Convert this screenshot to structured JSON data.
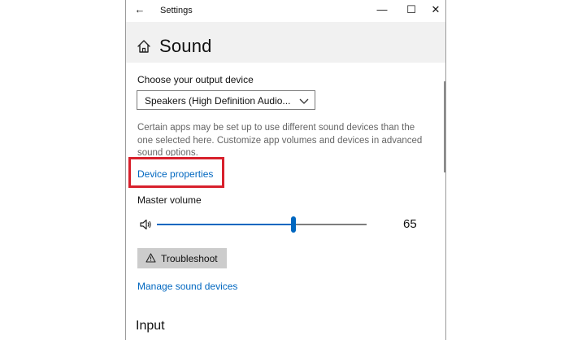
{
  "window": {
    "title": "Settings",
    "controls": {
      "back": "←",
      "minimize": "—",
      "maximize": "☐",
      "close": "✕"
    }
  },
  "page": {
    "title": "Sound"
  },
  "output": {
    "label": "Choose your output device",
    "selected_device": "Speakers (High Definition Audio...",
    "help_text": "Certain apps may be set up to use different sound devices than the one selected here. Customize app volumes and devices in advanced sound options.",
    "device_properties_link": "Device properties",
    "master_volume_label": "Master volume",
    "volume": 65,
    "volume_display": "65",
    "troubleshoot_label": "Troubleshoot",
    "manage_devices_link": "Manage sound devices"
  },
  "input": {
    "heading": "Input"
  },
  "colors": {
    "accent": "#0067c0",
    "highlight": "#d8202c"
  },
  "icons": {
    "back": "back-arrow-icon",
    "home": "home-icon",
    "chevron": "chevron-down-icon",
    "speaker": "speaker-icon",
    "warning": "warning-icon"
  }
}
